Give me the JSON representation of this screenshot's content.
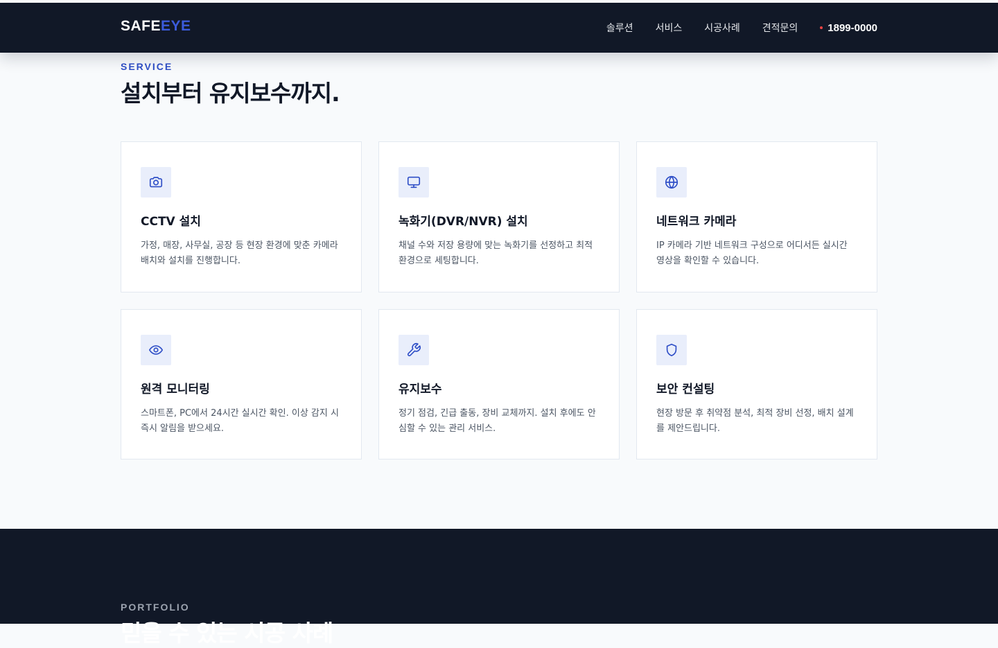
{
  "header": {
    "logo_main": "SAFE",
    "logo_accent": "EYE",
    "nav": [
      "솔루션",
      "서비스",
      "시공사례",
      "견적문의"
    ],
    "phone": "1899-0000"
  },
  "service": {
    "eyebrow": "SERVICE",
    "title": "설치부터 유지보수까지.",
    "cards": [
      {
        "icon": "camera-icon",
        "title": "CCTV 설치",
        "desc": "가정, 매장, 사무실, 공장 등 현장 환경에 맞춘 카메라 배치와 설치를 진행합니다."
      },
      {
        "icon": "monitor-icon",
        "title": "녹화기(DVR/NVR) 설치",
        "desc": "채널 수와 저장 용량에 맞는 녹화기를 선정하고 최적 환경으로 세팅합니다."
      },
      {
        "icon": "globe-icon",
        "title": "네트워크 카메라",
        "desc": "IP 카메라 기반 네트워크 구성으로 어디서든 실시간 영상을 확인할 수 있습니다."
      },
      {
        "icon": "eye-icon",
        "title": "원격 모니터링",
        "desc": "스마트폰, PC에서 24시간 실시간 확인. 이상 감지 시 즉시 알림을 받으세요."
      },
      {
        "icon": "wrench-icon",
        "title": "유지보수",
        "desc": "정기 점검, 긴급 출동, 장비 교체까지. 설치 후에도 안심할 수 있는 관리 서비스."
      },
      {
        "icon": "shield-icon",
        "title": "보안 컨설팅",
        "desc": "현장 방문 후 취약점 분석, 최적 장비 선정, 배치 설계를 제안드립니다."
      }
    ]
  },
  "portfolio": {
    "eyebrow": "PORTFOLIO",
    "title": "믿을 수 있는 시공 사례"
  },
  "colors": {
    "header_bg": "#111827",
    "accent": "#2f4fc7",
    "logo_accent": "#3b5bdb",
    "phone_dot": "#ef4444",
    "page_bg": "#f8fafc"
  }
}
